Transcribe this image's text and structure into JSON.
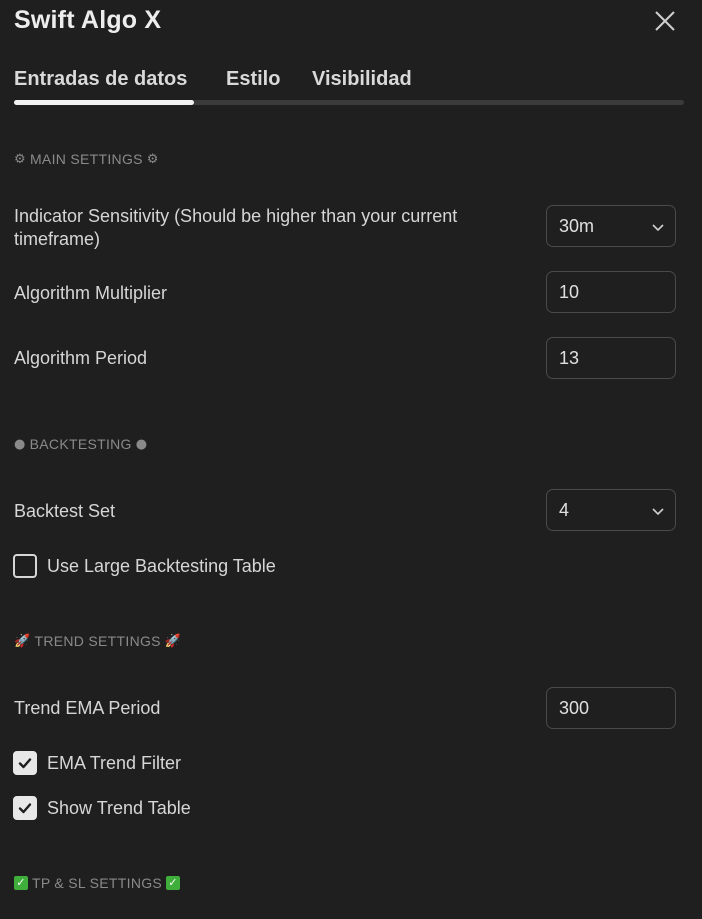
{
  "dialog": {
    "title": "Swift Algo X"
  },
  "tabs": [
    {
      "label": "Entradas de datos",
      "active": true
    },
    {
      "label": "Estilo",
      "active": false
    },
    {
      "label": "Visibilidad",
      "active": false
    }
  ],
  "sections": {
    "main": {
      "title": "MAIN SETTINGS",
      "icon": "gear-emoji"
    },
    "backtesting": {
      "title": "BACKTESTING",
      "icon": "white-circle-emoji"
    },
    "trend": {
      "title": "TREND SETTINGS",
      "icon": "rocket-emoji"
    },
    "tpsl": {
      "title": "TP & SL SETTINGS",
      "icon": "green-check-emoji"
    }
  },
  "main_settings": {
    "sensitivity_label": "Indicator Sensitivity (Should be higher than your current timeframe)",
    "sensitivity_value": "30m",
    "multiplier_label": "Algorithm Multiplier",
    "multiplier_value": "10",
    "period_label": "Algorithm Period",
    "period_value": "13"
  },
  "backtesting": {
    "set_label": "Backtest Set",
    "set_value": "4",
    "large_table_label": "Use Large Backtesting Table",
    "large_table_checked": false
  },
  "trend_settings": {
    "ema_period_label": "Trend EMA Period",
    "ema_period_value": "300",
    "ema_filter_label": "EMA Trend Filter",
    "ema_filter_checked": true,
    "show_table_label": "Show Trend Table",
    "show_table_checked": true
  },
  "colors": {
    "background": "#1f1f1f",
    "text": "#d6d6d6",
    "section_header": "#8a8a8a",
    "field_border": "#4a4a4a",
    "tab_indicator": "#f2f2f2",
    "check_green": "#3fae3a"
  }
}
